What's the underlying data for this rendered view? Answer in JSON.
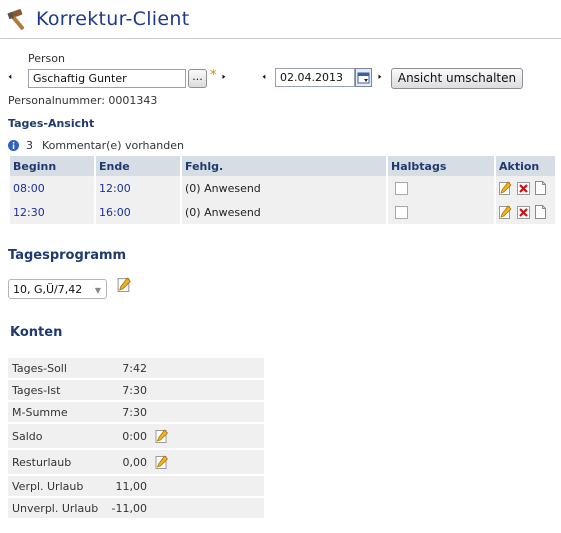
{
  "title": "Korrektur-Client",
  "person": {
    "label": "Person",
    "value": "Gschaftig Gunter",
    "browse_label": "...",
    "required_mark": "*"
  },
  "date": {
    "value": "02.04.2013"
  },
  "toggle_view_label": "Ansicht umschalten",
  "personalnummer": "Personalnummer: 0001343",
  "tages_ansicht": {
    "title": "Tages-Ansicht",
    "comments_count": "3",
    "comments_text": "Kommentar(e) vorhanden",
    "columns": [
      "Beginn",
      "Ende",
      "Fehlg.",
      "Halbtags",
      "Aktion"
    ],
    "rows": [
      {
        "begin": "08:00",
        "end": "12:00",
        "fehlg": "(0) Anwesend"
      },
      {
        "begin": "12:30",
        "end": "16:00",
        "fehlg": "(0) Anwesend"
      }
    ]
  },
  "tagesprogramm": {
    "title": "Tagesprogramm",
    "selected": "10, G,Ü/7,42"
  },
  "konten": {
    "title": "Konten",
    "rows": [
      {
        "label": "Tages-Soll",
        "value": "7:42",
        "editable": false
      },
      {
        "label": "Tages-Ist",
        "value": "7:30",
        "editable": false
      },
      {
        "label": "M-Summe",
        "value": "7:30",
        "editable": false
      },
      {
        "label": "Saldo",
        "value": "0:00",
        "editable": true
      },
      {
        "label": "Resturlaub",
        "value": "0,00",
        "editable": true
      },
      {
        "label": "Verpl. Urlaub",
        "value": "11,00",
        "editable": false
      },
      {
        "label": "Unverpl. Urlaub",
        "value": "-11,00",
        "editable": false
      }
    ]
  },
  "icons": {
    "title": "hammer-icon",
    "info": "info-icon",
    "calendar": "calendar-icon",
    "edit": "pencil-edit-icon",
    "delete": "delete-x-icon",
    "document": "document-icon"
  },
  "colors": {
    "title": "#1f3a8a",
    "header_bg": "#d7dde5",
    "row_bg": "#f0f0f0",
    "time_link": "#1a2fa0",
    "required": "#e07b00"
  }
}
